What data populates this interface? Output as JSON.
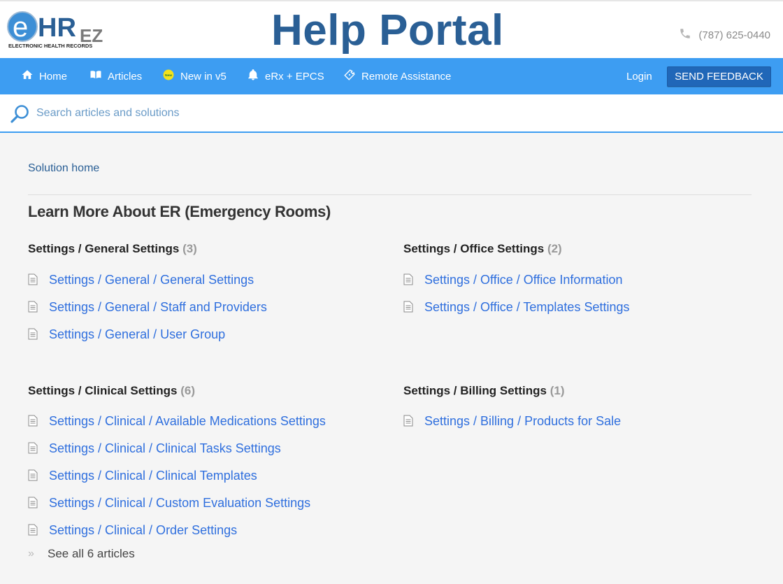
{
  "header": {
    "logo": {
      "main": "eHR",
      "suffix": "EZ",
      "tagline": "ELECTRONIC HEALTH RECORDS"
    },
    "title": "Help Portal",
    "phone": "(787) 625-0440"
  },
  "nav": {
    "items": [
      {
        "label": "Home",
        "icon": "home-icon"
      },
      {
        "label": "Articles",
        "icon": "book-icon"
      },
      {
        "label": "New in v5",
        "icon": "new-badge-icon"
      },
      {
        "label": "eRx + EPCS",
        "icon": "bell-icon"
      },
      {
        "label": "Remote Assistance",
        "icon": "ticket-icon"
      }
    ],
    "login": "Login",
    "feedback": "SEND FEEDBACK"
  },
  "search": {
    "placeholder": "Search articles and solutions",
    "value": ""
  },
  "breadcrumb": "Solution home",
  "page_title": "Learn More About ER (Emergency Rooms)",
  "sections": [
    {
      "title": "Settings / General Settings",
      "count": "(3)",
      "articles": [
        "Settings / General / General Settings",
        "Settings / General / Staff and Providers",
        "Settings / General / User Group"
      ]
    },
    {
      "title": "Settings / Office Settings",
      "count": "(2)",
      "articles": [
        "Settings / Office / Office Information",
        "Settings / Office / Templates Settings"
      ]
    },
    {
      "title": "Settings / Clinical Settings",
      "count": "(6)",
      "articles": [
        "Settings / Clinical / Available Medications Settings",
        "Settings / Clinical / Clinical Tasks Settings",
        "Settings / Clinical / Clinical Templates",
        "Settings / Clinical / Custom Evaluation Settings",
        "Settings / Clinical / Order Settings"
      ],
      "see_all": "See all 6 articles"
    },
    {
      "title": "Settings / Billing Settings",
      "count": "(1)",
      "articles": [
        "Settings / Billing / Products for Sale"
      ]
    }
  ],
  "colors": {
    "navbar": "#3d9df2",
    "title": "#2a5f95",
    "link": "#2f6fde",
    "feedback_button": "#2067b8"
  }
}
